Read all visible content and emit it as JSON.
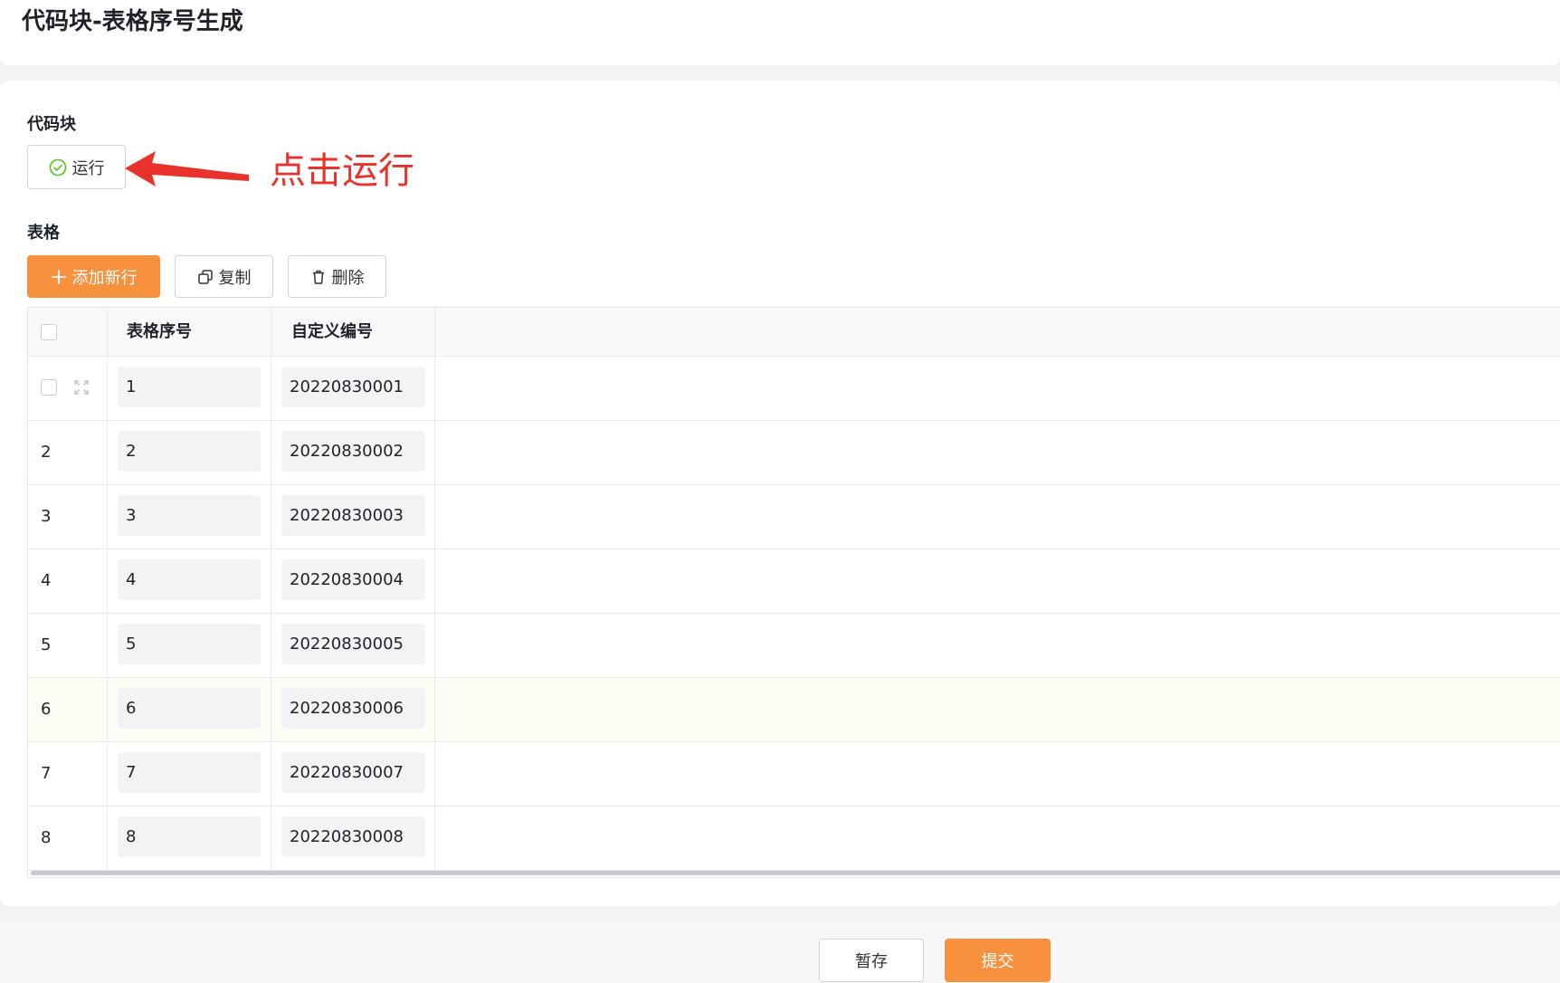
{
  "page": {
    "title": "代码块-表格序号生成"
  },
  "code_block": {
    "label": "代码块",
    "run_label": "运行",
    "run_icon": "check-circle-icon"
  },
  "annotation": {
    "text": "点击运行",
    "color": "#e8322b"
  },
  "table_section": {
    "label": "表格",
    "toolbar": {
      "add_label": "添加新行",
      "copy_label": "复制",
      "delete_label": "删除"
    },
    "columns": [
      "表格序号",
      "自定义编号"
    ],
    "rows": [
      {
        "index": "",
        "seq": "1",
        "code": "20220830001"
      },
      {
        "index": "2",
        "seq": "2",
        "code": "20220830002"
      },
      {
        "index": "3",
        "seq": "3",
        "code": "20220830003"
      },
      {
        "index": "4",
        "seq": "4",
        "code": "20220830004"
      },
      {
        "index": "5",
        "seq": "5",
        "code": "20220830005"
      },
      {
        "index": "6",
        "seq": "6",
        "code": "20220830006"
      },
      {
        "index": "7",
        "seq": "7",
        "code": "20220830007"
      },
      {
        "index": "8",
        "seq": "8",
        "code": "20220830008"
      }
    ]
  },
  "footer": {
    "save_label": "暂存",
    "submit_label": "提交"
  },
  "colors": {
    "accent": "#f7913d",
    "highlight_row": "#fdfdf6"
  }
}
